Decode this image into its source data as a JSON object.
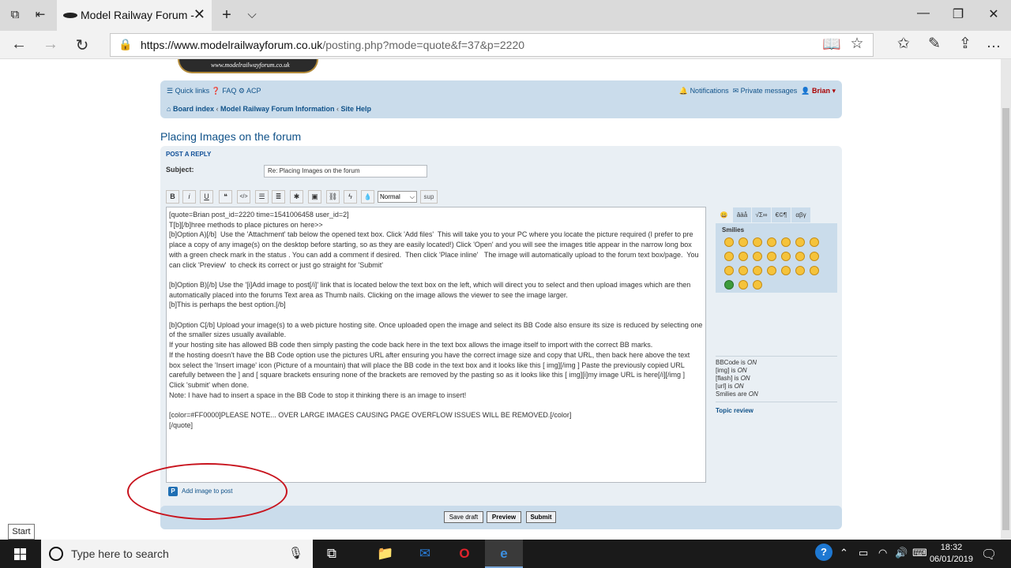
{
  "browser": {
    "tab_title": "Model Railway Forum -",
    "tab_close": "✕",
    "new_tab": "+",
    "tab_menu": "⌵",
    "url_host": "https://www.modelrailwayforum.co.uk",
    "url_path": "/posting.php?mode=quote&f=37&p=2220"
  },
  "banner": {
    "logo_text": "www.modelrailwayforum.co.uk"
  },
  "nav": {
    "quick_links": "Quick links",
    "faq": "FAQ",
    "acp": "ACP",
    "notifications": "Notifications",
    "private_messages": "Private messages",
    "user": "Brian",
    "breadcrumbs": [
      "Board index",
      "Model Railway Forum Information",
      "Site Help"
    ]
  },
  "page": {
    "title": "Placing Images on the forum",
    "post_a_reply": "POST A REPLY",
    "subject_label": "Subject:",
    "subject_value": "Re: Placing Images on the forum"
  },
  "toolbar": {
    "buttons": [
      "B",
      "i",
      "U",
      "❝",
      "</>",
      "☰",
      "≣",
      "✱",
      "▣",
      "⛓",
      "ϟ",
      "💧"
    ],
    "font_size": "Normal",
    "sup": "sup"
  },
  "message": {
    "lines": [
      "[quote=Brian post_id=2220 time=1541006458 user_id=2]",
      "T[b][/b]hree methods to place pictures on here>>",
      "[b]Option A)[/b]  Use the 'Attachment' tab below the opened text box. Click 'Add files'  This will take you to your PC where you locate the picture required (I prefer to pre place a copy of any image(s) on the desktop before starting, so as they are easily located!) Click 'Open' and you will see the images title appear in the narrow long box with a green check mark in the status . You can add a comment if desired.  Then click 'Place inline'   The image will automatically upload to the forum text box/page.  You can click 'Preview'  to check its correct or just go straight for 'Submit'",
      "",
      "[b]Option B)[/b] Use the '[i]Add image to post[/i]' link that is located below the text box on the left, which will direct you to select and then upload images which are then automatically placed into the forums Text area as Thumb nails. Clicking on the image allows the viewer to see the image larger.",
      "[b]This is perhaps the best option.[/b]",
      "",
      "[b]Option C[/b] Upload your image(s) to a web picture hosting site. Once uploaded open the image and select its BB Code also ensure its size is reduced by selecting one of the smaller sizes usually available.",
      "If your hosting site has allowed BB code then simply pasting the code back here in the text box allows the image itself to import with the correct BB marks.",
      "If the hosting doesn't have the BB Code option use the pictures URL after ensuring you have the correct image size and copy that URL, then back here above the text box select the 'Insert image' icon (Picture of a mountain) that will place the BB code in the text box and it looks like this [ img][/img ] Paste the previously copied URL carefully between the ] and [ square brackets ensuring none of the brackets are removed by the pasting so as it looks like this [ img][i]my image URL is here[/i][/img ]   Click 'submit' when done.",
      "Note: I have had to insert a space in the BB Code to stop it thinking there is an image to insert!",
      "",
      "[color=#FF0000]PLEASE NOTE... OVER LARGE IMAGES CAUSING PAGE OVERFLOW ISSUES WILL BE REMOVED.[/color]",
      "[/quote]"
    ]
  },
  "smilies": {
    "tabs": [
      "😀",
      "âäå",
      "√Σ∞",
      "€©¶",
      "αβγ"
    ],
    "title": "Smilies"
  },
  "bbinfo": {
    "bbcode": "BBCode is ",
    "img": "[img] is ",
    "flash": "[flash] is ",
    "url": "[url] is ",
    "smilies": "Smilies are ",
    "on": "ON",
    "topic_review": "Topic review"
  },
  "add_image": "Add image to post",
  "buttons": {
    "save_draft": "Save draft",
    "preview": "Preview",
    "submit": "Submit"
  },
  "tooltip": "Start",
  "taskbar": {
    "search_placeholder": "Type here to search",
    "time": "18:32",
    "date": "06/01/2019"
  },
  "colors": {
    "link": "#105289",
    "panel": "#cadceb",
    "ring": "#c8141e"
  }
}
